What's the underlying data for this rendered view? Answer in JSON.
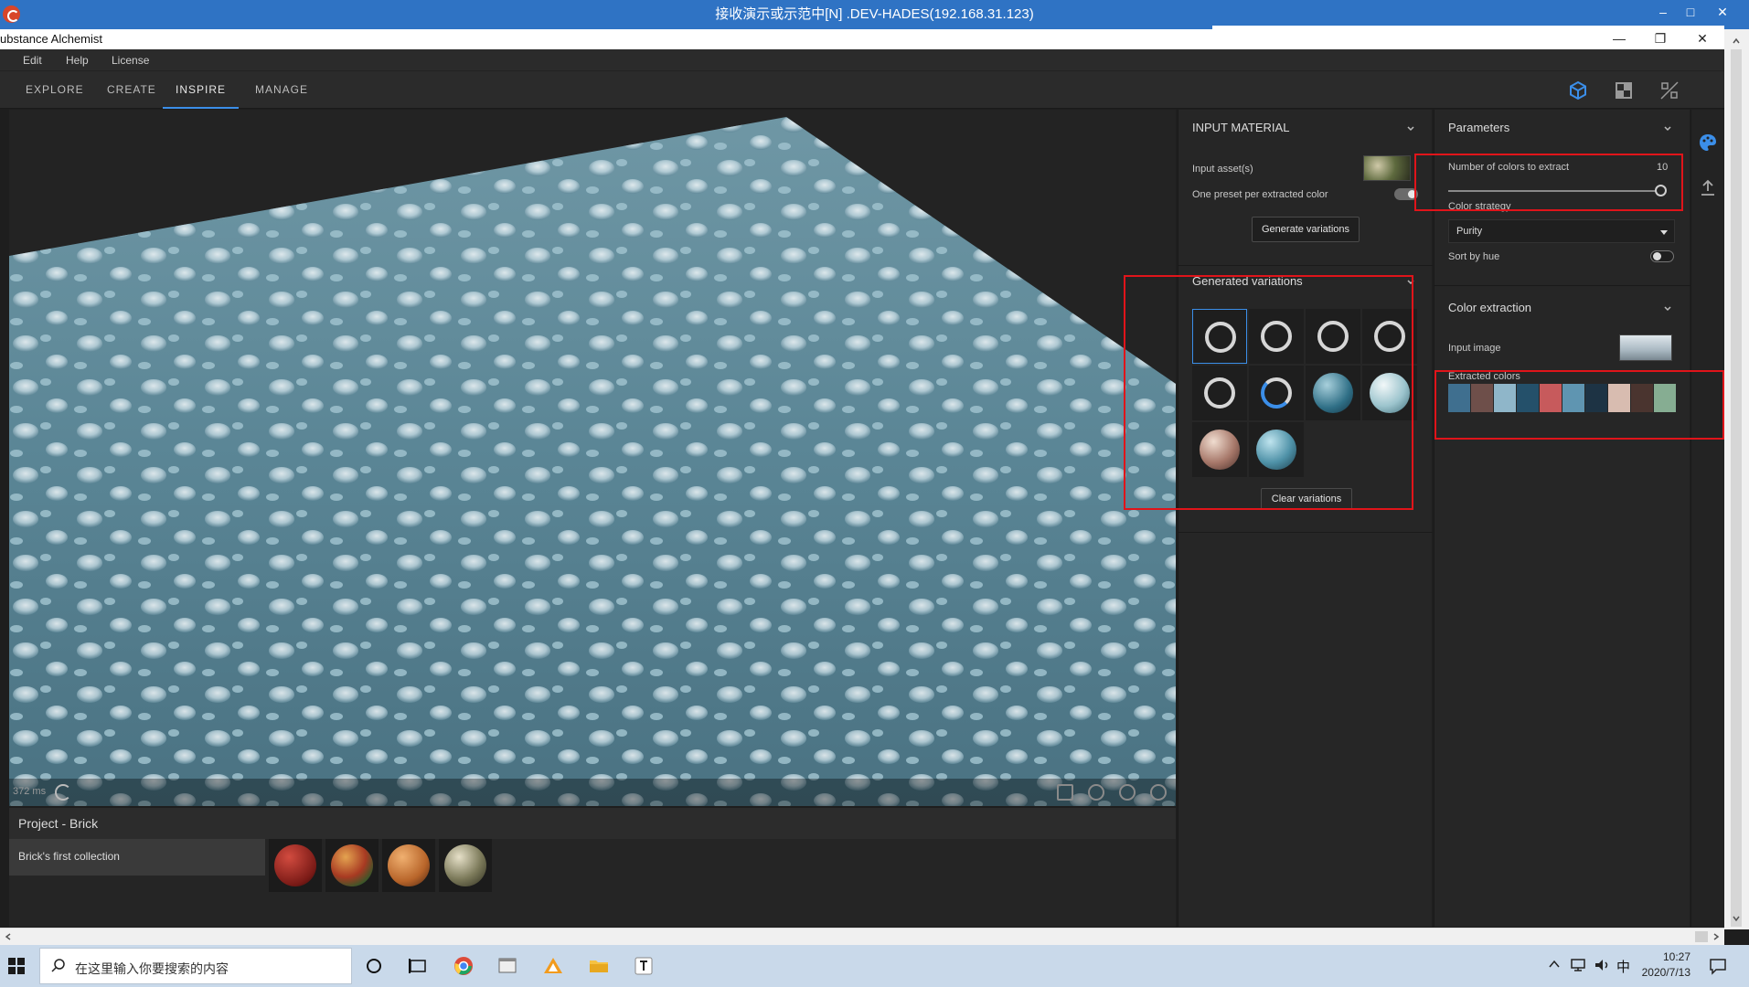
{
  "remote": {
    "title": "接收演示或示范中[N] .DEV-HADES(192.168.31.123)",
    "min": "–",
    "max": "□",
    "close": "✕"
  },
  "app": {
    "title": "ubstance Alchemist",
    "min": "—",
    "max": "❐",
    "close": "✕"
  },
  "menu": {
    "items": [
      "Edit",
      "Help",
      "License"
    ]
  },
  "nav": {
    "tabs": [
      "EXPLORE",
      "CREATE",
      "INSPIRE",
      "MANAGE"
    ],
    "active": "INSPIRE"
  },
  "viewport": {
    "ms": "372 ms"
  },
  "project": {
    "title": "Project - Brick",
    "collection": "Brick's first collection"
  },
  "input_material": {
    "title": "INPUT MATERIAL",
    "input_assets_label": "Input asset(s)",
    "one_preset_label": "One preset per extracted color",
    "generate_button": "Generate variations"
  },
  "generated": {
    "title": "Generated variations",
    "clear_button": "Clear variations"
  },
  "parameters": {
    "title": "Parameters",
    "num_colors_label": "Number of colors to extract",
    "num_colors_value": "10",
    "color_strategy_label": "Color strategy",
    "color_strategy_value": "Purity",
    "sort_by_hue_label": "Sort by hue"
  },
  "color_extraction": {
    "title": "Color extraction",
    "input_image_label": "Input image",
    "extracted_colors_label": "Extracted colors",
    "swatches": [
      "#3f6f8f",
      "#6e4f4a",
      "#8fb6c9",
      "#24506a",
      "#c75a5c",
      "#5f95b1",
      "#1d3344",
      "#d8bcb0",
      "#4a342f",
      "#86ad92"
    ]
  },
  "taskbar": {
    "search_placeholder": "在这里输入你要搜索的内容",
    "time": "10:27",
    "date": "2020/7/13",
    "ime": "中"
  }
}
